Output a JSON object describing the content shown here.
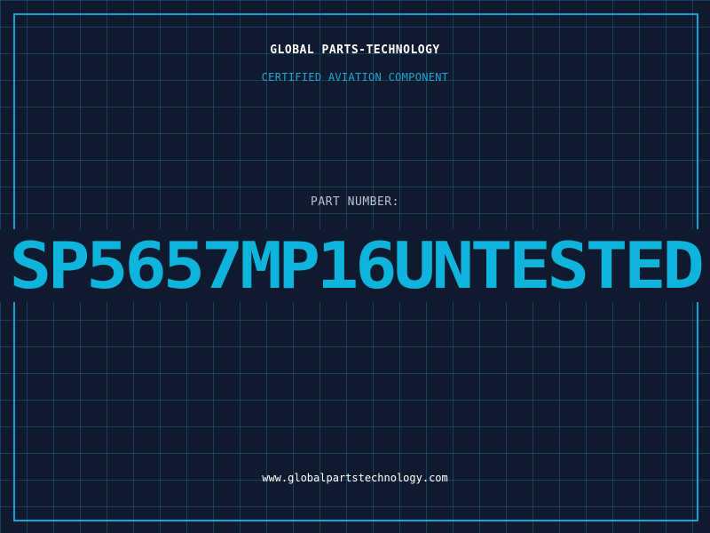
{
  "header": {
    "company": "GLOBAL PARTS-TECHNOLOGY",
    "subtitle": "CERTIFIED AVIATION COMPONENT"
  },
  "part": {
    "label": "PART NUMBER:",
    "number": "SP5657MP16UNTESTED"
  },
  "footer": {
    "url": "www.globalpartstechnology.com"
  },
  "colors": {
    "background": "#101a2e",
    "grid": "#1a6080",
    "accent": "#12a5cf",
    "part_number": "#0fb4dc",
    "text": "#ffffff",
    "label": "#b9c2cc"
  }
}
